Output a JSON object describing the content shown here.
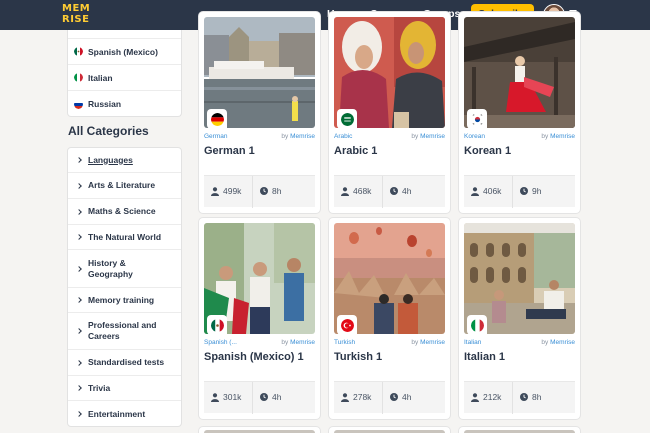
{
  "nav": {
    "logo_line1": "MEM",
    "logo_line2": "RISE",
    "home": "Home",
    "courses": "Courses",
    "groups": "Groups",
    "subscribe": "Subscribe"
  },
  "sidebar": {
    "languages": [
      {
        "label": "Spanish (Mexico)"
      },
      {
        "label": "Italian"
      },
      {
        "label": "Russian"
      }
    ],
    "categories_heading": "All Categories",
    "categories": [
      {
        "label": "Languages"
      },
      {
        "label": "Arts & Literature"
      },
      {
        "label": "Maths & Science"
      },
      {
        "label": "The Natural World"
      },
      {
        "label": "History & Geography"
      },
      {
        "label": "Memory training"
      },
      {
        "label": "Professional and Careers"
      },
      {
        "label": "Standardised tests"
      },
      {
        "label": "Trivia"
      },
      {
        "label": "Entertainment"
      }
    ]
  },
  "courses": [
    {
      "lang": "German",
      "by": "by",
      "author": "Memrise",
      "title": "German 1",
      "learners": "499k",
      "time": "8h"
    },
    {
      "lang": "Arabic",
      "by": "by",
      "author": "Memrise",
      "title": "Arabic 1",
      "learners": "468k",
      "time": "4h"
    },
    {
      "lang": "Korean",
      "by": "by",
      "author": "Memrise",
      "title": "Korean 1",
      "learners": "406k",
      "time": "9h"
    },
    {
      "lang": "Spanish (...",
      "by": "by",
      "author": "Memrise",
      "title": "Spanish (Mexico) 1",
      "learners": "301k",
      "time": "4h"
    },
    {
      "lang": "Turkish",
      "by": "by",
      "author": "Memrise",
      "title": "Turkish 1",
      "learners": "278k",
      "time": "4h"
    },
    {
      "lang": "Italian",
      "by": "by",
      "author": "Memrise",
      "title": "Italian 1",
      "learners": "212k",
      "time": "8h"
    }
  ],
  "colors": {
    "nav_bg": "#2b3648",
    "accent": "#ffbf00",
    "link": "#3a8fd6"
  },
  "icons": {
    "user": "user-icon",
    "clock": "clock-icon",
    "chevron": "chevron-right-icon"
  }
}
